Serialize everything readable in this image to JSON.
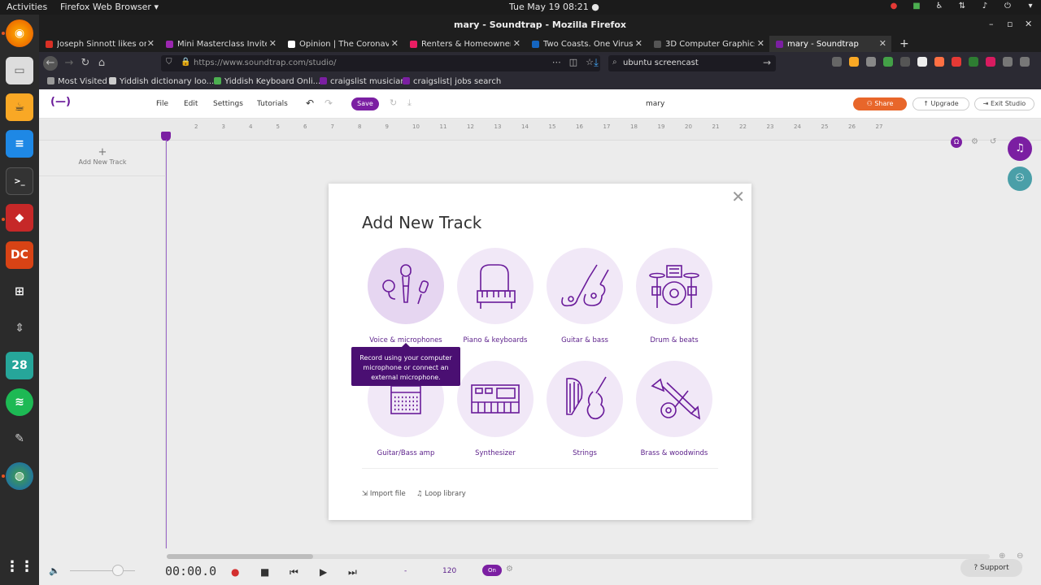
{
  "topbar": {
    "activities": "Activities",
    "app_menu": "Firefox Web Browser ▾",
    "clock": "Tue May 19  08:21  ●"
  },
  "window": {
    "title": "mary - Soundtrap - Mozilla Firefox"
  },
  "tabs": [
    {
      "label": "Joseph Sinnott likes one",
      "color": "#d93025"
    },
    {
      "label": "Mini Masterclass Invite:",
      "color": "#9c27b0"
    },
    {
      "label": "Opinion | The Coronavir",
      "color": "#ffffff"
    },
    {
      "label": "Renters & Homeowners",
      "color": "#e91e63"
    },
    {
      "label": "Two Coasts. One Virus. H",
      "color": "#1565c0"
    },
    {
      "label": "3D Computer Graphics U",
      "color": "#555555"
    },
    {
      "label": "mary - Soundtrap",
      "color": "#7b1fa2"
    }
  ],
  "navbar": {
    "url": "https://www.soundtrap.com/studio/",
    "search": "ubuntu screencast"
  },
  "bookmarks": [
    {
      "label": "Most Visited",
      "color": "#999999"
    },
    {
      "label": "Yiddish dictionary loo...",
      "color": "#cccccc"
    },
    {
      "label": "Yiddish Keyboard Onli...",
      "color": "#4caf50"
    },
    {
      "label": "craigslist musician",
      "color": "#7b1fa2"
    },
    {
      "label": "craigslist| jobs search",
      "color": "#7b1fa2"
    }
  ],
  "app": {
    "logo": "(—)",
    "menu": [
      "File",
      "Edit",
      "Settings",
      "Tutorials"
    ],
    "save": "Save",
    "project_name": "mary",
    "share": "Share",
    "upgrade": "↑ Upgrade",
    "exit": "⇥ Exit Studio",
    "add_track": "Add New Track",
    "ruler_ticks": [
      "2",
      "3",
      "4",
      "5",
      "6",
      "7",
      "8",
      "9",
      "10",
      "11",
      "12",
      "13",
      "14",
      "15",
      "16",
      "17",
      "18",
      "19",
      "20",
      "21",
      "22",
      "23",
      "24",
      "25",
      "26",
      "27"
    ]
  },
  "modal": {
    "title": "Add New Track",
    "tiles": [
      {
        "label": "Voice & microphones",
        "icon": "microphone-icon"
      },
      {
        "label": "Piano & keyboards",
        "icon": "piano-icon"
      },
      {
        "label": "Guitar & bass",
        "icon": "guitar-icon"
      },
      {
        "label": "Drum & beats",
        "icon": "drums-icon"
      },
      {
        "label": "Guitar/Bass amp",
        "icon": "amp-icon"
      },
      {
        "label": "Synthesizer",
        "icon": "synth-icon"
      },
      {
        "label": "Strings",
        "icon": "strings-icon"
      },
      {
        "label": "Brass & woodwinds",
        "icon": "brass-icon"
      }
    ],
    "tooltip": "Record using your computer microphone or connect an external microphone.",
    "import_file": "Import file",
    "loop_library": "Loop library"
  },
  "transport": {
    "timecode": "00:00.0",
    "key": "-",
    "tempo": "120",
    "metronome": "On",
    "support": "Support"
  },
  "colors": {
    "accent": "#7b1fa2",
    "share": "#e8662a"
  }
}
